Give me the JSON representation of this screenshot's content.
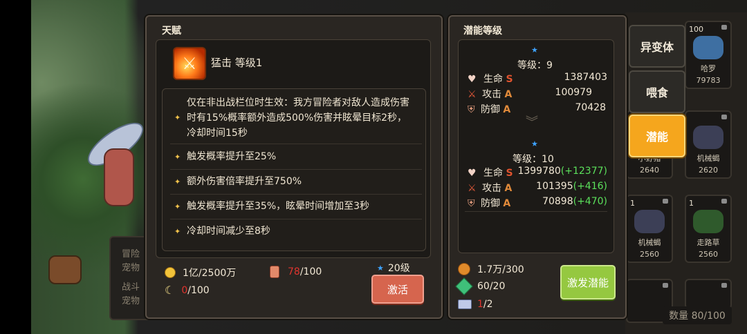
{
  "background": {
    "side_panel_lines": [
      "冒险",
      "宠物",
      "战斗",
      "宠物"
    ]
  },
  "right_tabs": [
    {
      "label": "异变体",
      "active": false
    },
    {
      "label": "喂食",
      "active": false
    },
    {
      "label": "潜能",
      "active": true
    }
  ],
  "right_cards": [
    {
      "level": "100",
      "name": "哈罗",
      "num": "79783"
    },
    {
      "level": "",
      "name": "小野猪",
      "num": "2640"
    },
    {
      "level": "",
      "name": "机械蝎",
      "num": "2620"
    },
    {
      "level": "1",
      "name": "机械蝎",
      "num": "2560"
    },
    {
      "level": "1",
      "name": "走路草",
      "num": "2560"
    }
  ],
  "quantity": "数量 80/100",
  "talent": {
    "title": "天赋",
    "skill_name": "猛击 等级1",
    "effects": [
      "仅在非出战栏位时生效：我方冒险者对敌人造成伤害时有15%概率额外造成500%伤害并眩晕目标2秒，冷却时间15秒",
      "触发概率提升至25%",
      "额外伤害倍率提升至750%",
      "触发概率提升至35%，眩晕时间增加至3秒",
      "冷却时间减少至8秒"
    ],
    "gold": "1亿/2500万",
    "potion_have": "78",
    "potion_need": "/100",
    "banana_have": "0",
    "banana_need": "/100",
    "required_level": "20级",
    "activate_label": "激活"
  },
  "potential": {
    "title": "潜能等级",
    "current": {
      "level_label": "等级：9",
      "stats": [
        {
          "name": "生命",
          "grade": "S",
          "value": "1387403",
          "delta": ""
        },
        {
          "name": "攻击",
          "grade": "A",
          "value": "100979",
          "delta": ""
        },
        {
          "name": "防御",
          "grade": "A",
          "value": "70428",
          "delta": ""
        }
      ]
    },
    "next": {
      "level_label": "等级：10",
      "stats": [
        {
          "name": "生命",
          "grade": "S",
          "value": "1399780",
          "delta": "(+12377)"
        },
        {
          "name": "攻击",
          "grade": "A",
          "value": "101395",
          "delta": "(+416)"
        },
        {
          "name": "防御",
          "grade": "A",
          "value": "70898",
          "delta": "(+470)"
        }
      ]
    },
    "costs": [
      {
        "icon": "seed-icon",
        "value": "1.7万/300"
      },
      {
        "icon": "crystal-icon",
        "value": "60/20"
      },
      {
        "icon": "ticket-icon",
        "have": "1",
        "need": "/2"
      }
    ],
    "button_label": "激发潜能"
  }
}
